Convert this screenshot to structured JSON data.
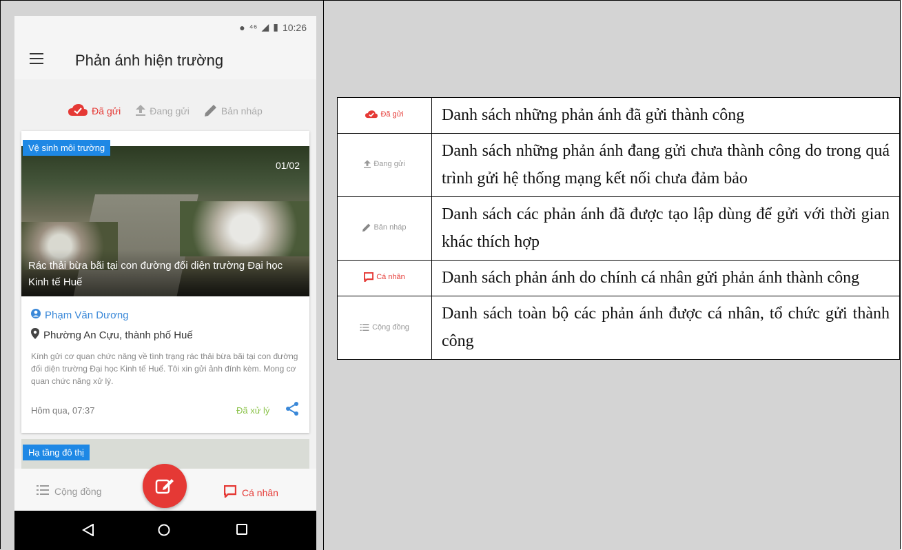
{
  "phone": {
    "status_bar": {
      "time": "10:26"
    },
    "app_title": "Phản ánh hiện trường",
    "tabs": [
      {
        "label": "Đã gửi",
        "icon": "cloud-check-icon",
        "active": true
      },
      {
        "label": "Đang gửi",
        "icon": "upload-icon",
        "active": false
      },
      {
        "label": "Bản nháp",
        "icon": "pencil-icon",
        "active": false
      }
    ],
    "card": {
      "category": "Vệ sinh môi trường",
      "counter": "01/02",
      "caption": "Rác thải bừa bãi tại con đường đối diện trường Đại học Kinh tế Huế",
      "author": "Phạm Văn Dương",
      "location": "Phường An Cựu, thành phố Huế",
      "description": "Kính gửi cơ quan chức năng về tình trạng rác thải bừa bãi tại con đường đối diện trường Đại học Kinh tế Huế. Tôi xin gửi ảnh đính kèm. Mong cơ quan chức năng xử lý.",
      "time": "Hôm qua, 07:37",
      "status": "Đã xử lý"
    },
    "card2": {
      "category": "Hạ tầng đô thị"
    },
    "bottom_nav": {
      "left_label": "Cộng đồng",
      "right_label": "Cá nhân"
    }
  },
  "legend_table": {
    "rows": [
      {
        "icon_label": "Đã gửi",
        "icon": "cloud-check-icon",
        "text": "Danh sách những phản ánh đã gửi thành công"
      },
      {
        "icon_label": "Đang gửi",
        "icon": "upload-icon",
        "text": "Danh sách những phản ánh đang gửi chưa thành công do trong quá trình gửi hệ thống mạng kết nối chưa đảm bảo"
      },
      {
        "icon_label": "Bản nháp",
        "icon": "pencil-icon",
        "text": "Danh sách các phản ánh đã được tạo lập dùng để gửi với thời gian khác thích hợp"
      },
      {
        "icon_label": "Cá nhân",
        "icon": "message-square-icon",
        "text": "Danh sách phản ánh do chính cá nhân gửi phản ánh thành công"
      },
      {
        "icon_label": "Cộng đồng",
        "icon": "list-icon",
        "text": "Danh sách toàn bộ các phản ánh được cá nhân, tổ chức gửi thành công"
      }
    ]
  },
  "colors": {
    "accent": "#e53935",
    "link": "#3a88d8",
    "badge": "#1e88e5",
    "done": "#8bc34a"
  }
}
